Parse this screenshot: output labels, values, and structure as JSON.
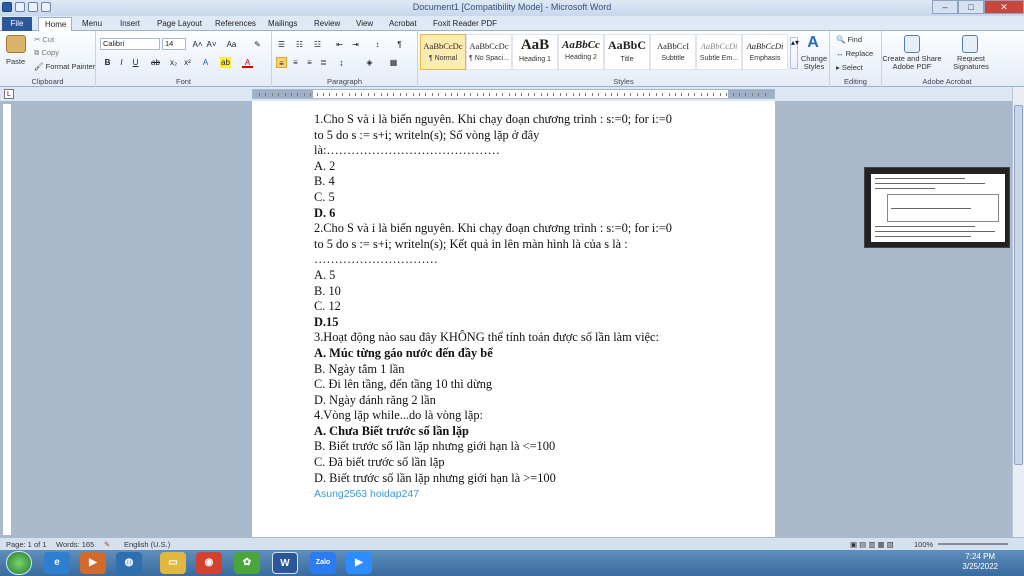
{
  "window": {
    "title": "Document1 [Compatibility Mode] - Microsoft Word"
  },
  "tabs": [
    "File",
    "Home",
    "Menu",
    "Insert",
    "Page Layout",
    "References",
    "Mailings",
    "Review",
    "View",
    "Acrobat",
    "Foxit Reader PDF"
  ],
  "ribbon": {
    "clipboard": {
      "paste": "Paste",
      "cut": "Cut",
      "copy": "Copy",
      "format_painter": "Format Painter",
      "label": "Clipboard"
    },
    "font": {
      "name": "Calibri",
      "size": "14",
      "label": "Font"
    },
    "paragraph": {
      "label": "Paragraph"
    },
    "styles": {
      "label": "Styles",
      "items": [
        {
          "sample": "AaBbCcDc",
          "name": "¶ Normal"
        },
        {
          "sample": "AaBbCcDc",
          "name": "¶ No Spaci..."
        },
        {
          "sample": "AaB",
          "name": "Heading 1"
        },
        {
          "sample": "AaBbCc",
          "name": "Heading 2"
        },
        {
          "sample": "AaBbC",
          "name": "Title"
        },
        {
          "sample": "AaBbCcI",
          "name": "Subtitle"
        },
        {
          "sample": "AaBbCcDi",
          "name": "Subtle Em..."
        },
        {
          "sample": "AaBbCcDi",
          "name": "Emphasis"
        }
      ],
      "change_styles": "Change Styles"
    },
    "editing": {
      "find": "Find",
      "replace": "Replace",
      "select": "Select",
      "label": "Editing"
    },
    "acrobat": {
      "create": "Create and Share Adobe PDF",
      "request": "Request Signatures",
      "label": "Adobe Acrobat"
    }
  },
  "document": {
    "lines": [
      {
        "text": "1.Cho S và i là biến nguyên. Khi chạy đoạn chương trình : s:=0; for i:=0",
        "bold": false
      },
      {
        "text": "to 5 do s := s+i; writeln(s); Số vòng lặp ở đây",
        "bold": false
      },
      {
        "text": "là:……………………………………",
        "bold": false
      },
      {
        "text": "A. 2",
        "bold": false
      },
      {
        "text": "B. 4",
        "bold": false
      },
      {
        "text": "C. 5",
        "bold": false
      },
      {
        "text": "D. 6",
        "bold": true
      },
      {
        "text": "2.Cho S và i là biến nguyên. Khi chạy đoạn chương trình : s:=0; for i:=0",
        "bold": false
      },
      {
        "text": "to 5 do s := s+i; writeln(s); Kết quả in lên màn hình là của s là :",
        "bold": false
      },
      {
        "text": "…………………………",
        "bold": false
      },
      {
        "text": "A. 5",
        "bold": false
      },
      {
        "text": "B. 10",
        "bold": false
      },
      {
        "text": "C. 12",
        "bold": false
      },
      {
        "text": "D.15",
        "bold": true
      },
      {
        "text": "3.Hoạt động nào sau đây KHÔNG thể tính toán được số lần làm việc:",
        "bold": false
      },
      {
        "text": "A. Múc từng gáo nước đến đầy bể",
        "bold": true
      },
      {
        "text": "B. Ngày tắm 1 lần",
        "bold": false
      },
      {
        "text": "C. Đi lên tầng, đến tầng 10 thì dừng",
        "bold": false
      },
      {
        "text": "D. Ngày đánh răng 2 lần",
        "bold": false
      },
      {
        "text": "4.Vòng lặp while...do là vòng lặp:",
        "bold": false
      },
      {
        "text": "A. Chưa Biết trước số lần lặp",
        "bold": true
      },
      {
        "text": "B. Biết trước số lần lặp nhưng giới hạn là <=100",
        "bold": false
      },
      {
        "text": "C. Đã biết trước số lần lặp",
        "bold": false
      },
      {
        "text": "D. Biết trước số lần lặp nhưng giới hạn là >=100",
        "bold": false
      }
    ],
    "signature": "Asung2563  hoidap247"
  },
  "status": {
    "page": "Page: 1 of 1",
    "words": "Words: 165",
    "language": "English (U.S.)",
    "zoom": "100%"
  },
  "clock": {
    "time": "7:24 PM",
    "date": "3/25/2022"
  },
  "taskbar": {
    "zalo": "Zalo"
  }
}
